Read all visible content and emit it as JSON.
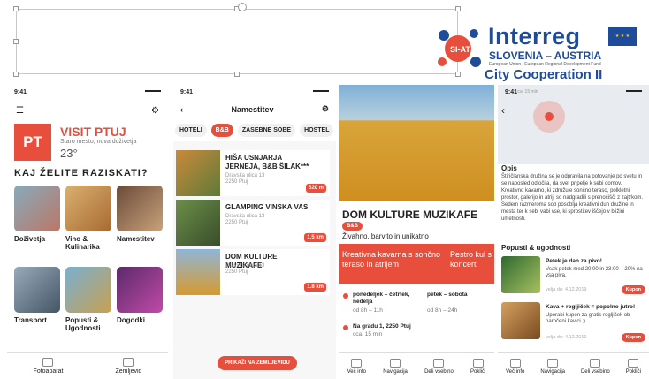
{
  "header": {
    "interreg": "Interreg",
    "eu_flag_stars": "★ ★ ★",
    "country": "SLOVENIA – AUSTRIA",
    "fund": "European Union | European Regional Development Fund",
    "project": "City Cooperation II",
    "logo_mark": "SI-AT",
    "brand_color": "#1f4b9b"
  },
  "screen1": {
    "time": "9:41",
    "brand_logo": "PT",
    "title": "VISIT PTUJ",
    "subtitle": "Staro mesto, nova doživetja",
    "temperature": "23°",
    "section": "KAJ ŽELITE RAZISKATI?",
    "tiles": [
      "Doživetja",
      "Vino & Kulinarika",
      "Namestitev",
      "Transport",
      "Popusti & Ugodnosti",
      "Dogodki"
    ],
    "nav": [
      "Fotoaparat",
      "Zemljevid"
    ],
    "accent": "#e84e3c"
  },
  "screen2": {
    "time": "9:41",
    "title": "Namestitev",
    "tabs": [
      "HOTELI",
      "B&B",
      "ZASEBNE SOBE",
      "HOSTEL"
    ],
    "cards": [
      {
        "title": "HIŠA USNJARJA JERNEJA, B&B ŠILAK***",
        "addr1": "Dravska ulica 13",
        "addr2": "2250 Ptuj",
        "dist": "520 m"
      },
      {
        "title": "GLAMPING VINSKA VAS",
        "addr1": "Dravska ulica 13",
        "addr2": "2250 Ptuj",
        "dist": "1.5 km"
      },
      {
        "title": "DOM KULTURE MUZIKAFE",
        "addr1": "Dravska ulica 13",
        "addr2": "2250 Ptuj",
        "dist": "1.8 km"
      }
    ],
    "map_button": "PRIKAŽI NA ZEMLJEVIDU"
  },
  "screen3": {
    "title": "DOM KULTURE MUZIKAFE",
    "badge": "B&B",
    "tagline": "Živahno, barvito in unikatno",
    "promo1": "Kreativna kavarna s sončno teraso in atrijem",
    "promo2": "Pestro kul s koncerti",
    "hours": [
      {
        "days": "ponedeljek – četrtek, nedelja",
        "time": "od 8h – 11h"
      },
      {
        "days": "petek – sobota",
        "time": "od 8h – 24h"
      }
    ],
    "address": "Na gradu 1, 2250 Ptuj",
    "distance": "cca. 15 min",
    "actions": [
      "Več info",
      "Navigacija",
      "Deli vsebino",
      "Pokliči"
    ]
  },
  "screen4": {
    "time": "9:41",
    "distance": "cca. 15 min",
    "desc_heading": "Opis",
    "description": "Štiričlanska družina se je odpravila na potovanje po svetu in se naposled odločila, da svet pripelje k sebi domov. Kreativno kavarno, ki združuje sončno teraso, polkletni prostor, galerijo in atrij, so nadgradili s prenočišči z zajtrkom. Sedem razmeroma sob posoblja kreativni duh družine in mesta ter k sebi vabi vse, ki sprostitev iščejo v bližini umetnosti.",
    "offers_heading": "Popusti & ugodnosti",
    "offers": [
      {
        "title": "Petek je dan za pivo!",
        "text": "Vsak petek med 20:00 in 23:00 – 20% na vsa piva.",
        "date": "velja do: 4.12.2019",
        "coupon": "Kupon"
      },
      {
        "title": "Kava + rogljiček = popolno jutro!",
        "text": "Uporabi kupon za gratis rogljiček ob naročeni kavici ;)",
        "date": "velja do: 4.12.2019",
        "coupon": "Kupon"
      }
    ],
    "actions": [
      "Več info",
      "Navigacija",
      "Deli vsebino",
      "Pokliči"
    ]
  }
}
